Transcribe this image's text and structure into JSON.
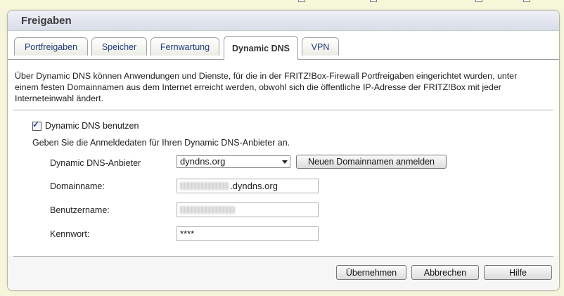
{
  "panel": {
    "title": "Freigaben"
  },
  "tabs": [
    {
      "label": "Portfreigaben",
      "active": false
    },
    {
      "label": "Speicher",
      "active": false
    },
    {
      "label": "Fernwartung",
      "active": false
    },
    {
      "label": "Dynamic DNS",
      "active": true
    },
    {
      "label": "VPN",
      "active": false
    }
  ],
  "intro": {
    "line1": "Über Dynamic DNS können Anwendungen und Dienste, für die in der FRITZ!Box-Firewall Portfreigaben eingerichtet wurden, unter",
    "line2": "einem festen Domainnamen aus dem Internet erreicht werden, obwohl sich die öffentliche IP-Adresse der FRITZ!Box mit jeder",
    "line3": "Interneteinwahl ändert."
  },
  "form": {
    "use_ddns_label": "Dynamic DNS benutzen",
    "use_ddns_checked": true,
    "hint": "Geben Sie die Anmeldedaten für Ihren Dynamic DNS-Anbieter an.",
    "provider_label": "Dynamic DNS-Anbieter",
    "provider_value": "dyndns.org",
    "register_button": "Neuen Domainnamen anmelden",
    "domain_label": "Domainname:",
    "domain_suffix": ".dyndns.org",
    "username_label": "Benutzername:",
    "password_label": "Kennwort:",
    "password_value": "****"
  },
  "actions": {
    "apply": "Übernehmen",
    "cancel": "Abbrechen",
    "help": "Hilfe"
  },
  "colors": {
    "tab_text": "#1f3d7a",
    "header_bg": "#dde1ea",
    "page_bg": "#f5f5dc"
  }
}
